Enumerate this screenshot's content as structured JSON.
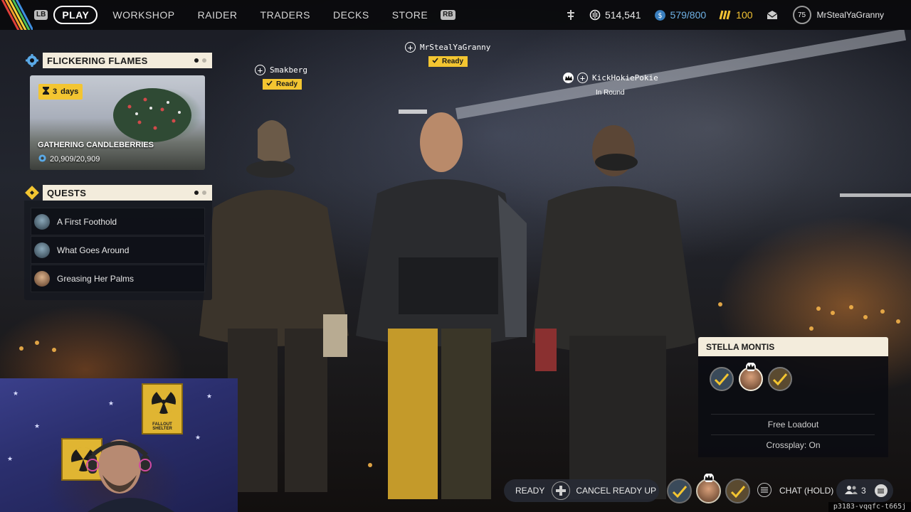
{
  "nav": {
    "lb": "LB",
    "rb": "RB",
    "items": [
      "PLAY",
      "WORKSHOP",
      "RAIDER",
      "TRADERS",
      "DECKS",
      "STORE"
    ]
  },
  "currency": {
    "coins": "514,541",
    "blue": "579/800",
    "gold": "100"
  },
  "profile": {
    "level": "75",
    "username": "MrStealYaGranny"
  },
  "event": {
    "header": "FLICKERING FLAMES",
    "days_count": "3",
    "days_label": "days",
    "title": "GATHERING CANDLEBERRIES",
    "progress": "20,909/20,909"
  },
  "quests": {
    "header": "QUESTS",
    "items": [
      "A First Foothold",
      "What Goes Around",
      "Greasing Her Palms"
    ]
  },
  "players": [
    {
      "name": "Smakberg",
      "status": "Ready"
    },
    {
      "name": "MrStealYaGranny",
      "status": "Ready"
    },
    {
      "name": "KickHokiePokie",
      "status": "In Round"
    }
  ],
  "lobby": {
    "title": "STELLA MONTIS",
    "loadout": "Free Loadout",
    "crossplay": "Crossplay: On"
  },
  "bottom": {
    "ready": "READY",
    "cancel": "CANCEL READY UP",
    "chat": "CHAT (HOLD)",
    "party_count": "3",
    "session_id": "p3183-vqqfc-t665j"
  },
  "webcam": {
    "sign_text": "FALLOUT SHELTER"
  },
  "colors": {
    "accent_yellow": "#f3c531",
    "header_cream": "#f3ecdc",
    "blue_currency": "#6fb2e6",
    "gold_currency": "#f2c233"
  }
}
